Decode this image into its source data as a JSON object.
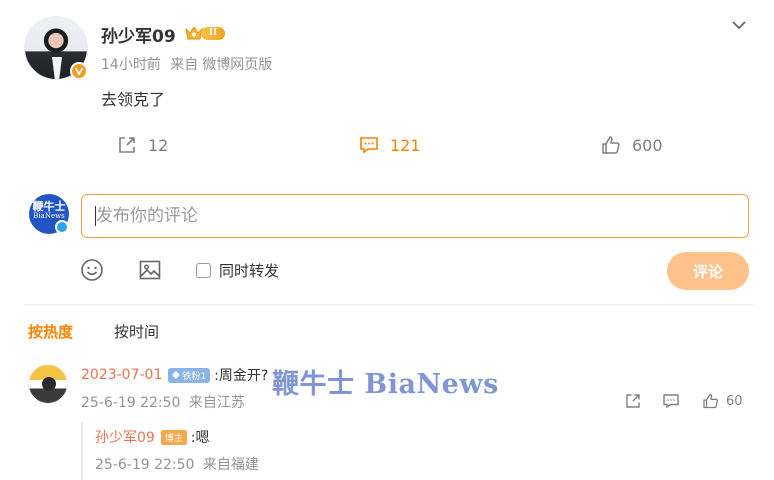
{
  "post": {
    "author": "孙少军09",
    "vip_level": "II",
    "time": "14小时前",
    "source_prefix": "来自",
    "source": "微博网页版",
    "text": "去领克了"
  },
  "actions": {
    "repost_count": "12",
    "comment_count": "121",
    "like_count": "600"
  },
  "composer": {
    "avatar_text": "鞭牛士",
    "avatar_subtext": "BiaNews",
    "placeholder": "发布你的评论",
    "repost_label": "同时转发",
    "submit_label": "评论"
  },
  "sort": {
    "hot": "按热度",
    "time": "按时间"
  },
  "comment": {
    "user": "2023-07-01",
    "fan_badge": "铁粉1",
    "text": ":周金开?",
    "time": "25-6-19 22:50",
    "location": "来自江苏",
    "like_count": "60"
  },
  "reply": {
    "user": "孙少军09",
    "badge": "博主",
    "text": ":嗯",
    "time": "25-6-19 22:50",
    "location": "来自福建"
  },
  "watermark": "鞭牛士 BiaNews",
  "colors": {
    "accent": "#ff8200",
    "username": "#eb7350",
    "input_border": "#f0a23a",
    "submit_bg": "#ffc28a"
  }
}
